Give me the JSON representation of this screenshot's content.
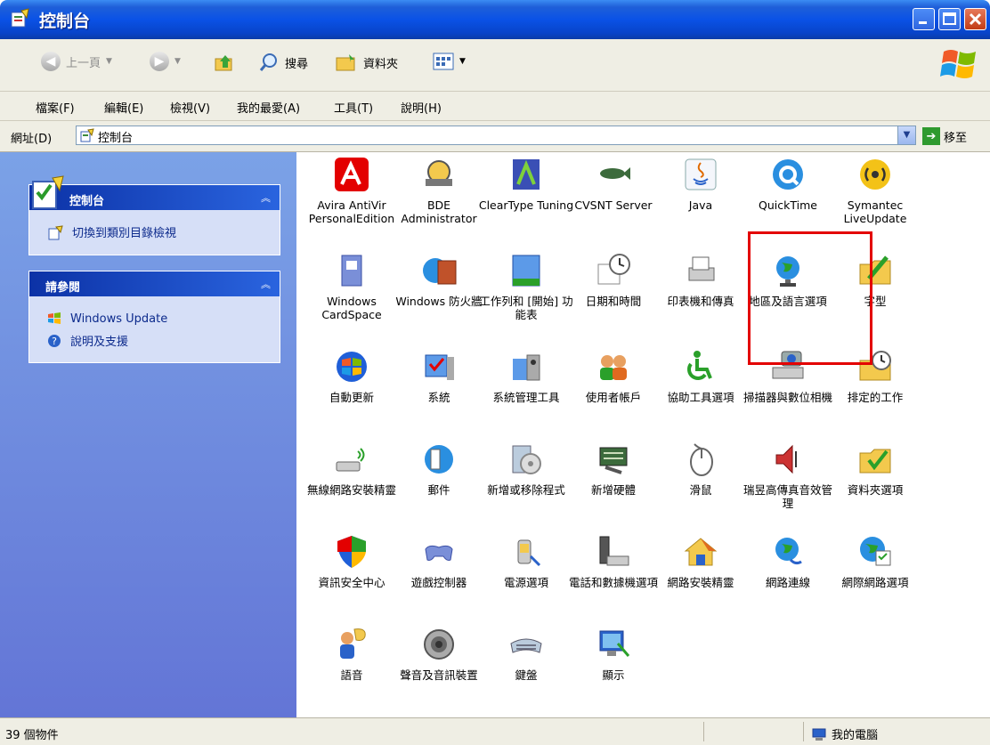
{
  "window": {
    "title": "控制台"
  },
  "toolbar": {
    "back": "上一頁",
    "search": "搜尋",
    "folders": "資料夾"
  },
  "menu": [
    "檔案(F)",
    "編輯(E)",
    "檢視(V)",
    "我的最愛(A)",
    "工具(T)",
    "說明(H)"
  ],
  "address": {
    "label": "網址(D)",
    "value": "控制台",
    "go": "移至"
  },
  "sidebar": {
    "panel1": {
      "title": "控制台",
      "link": "切換到類別目錄檢視"
    },
    "panel2": {
      "title": "請參閱",
      "links": [
        "Windows Update",
        "說明及支援"
      ]
    }
  },
  "items": [
    "Avira AntiVir PersonalEdition",
    "BDE Administrator",
    "ClearType Tuning",
    "CVSNT Server",
    "Java",
    "QuickTime",
    "Symantec LiveUpdate",
    "Windows CardSpace",
    "Windows 防火牆",
    "工作列和 [開始] 功能表",
    "日期和時間",
    "印表機和傳真",
    "地區及語言選項",
    "字型",
    "自動更新",
    "系統",
    "系統管理工具",
    "使用者帳戶",
    "協助工具選項",
    "掃描器與數位相機",
    "排定的工作",
    "無線網路安裝精靈",
    "郵件",
    "新增或移除程式",
    "新增硬體",
    "滑鼠",
    "瑞昱高傳真音效管理",
    "資料夾選項",
    "資訊安全中心",
    "遊戲控制器",
    "電源選項",
    "電話和數據機選項",
    "網路安裝精靈",
    "網路連線",
    "網際網路選項",
    "語音",
    "聲音及音訊裝置",
    "鍵盤",
    "顯示"
  ],
  "status": {
    "count": "39 個物件",
    "location": "我的電腦"
  }
}
